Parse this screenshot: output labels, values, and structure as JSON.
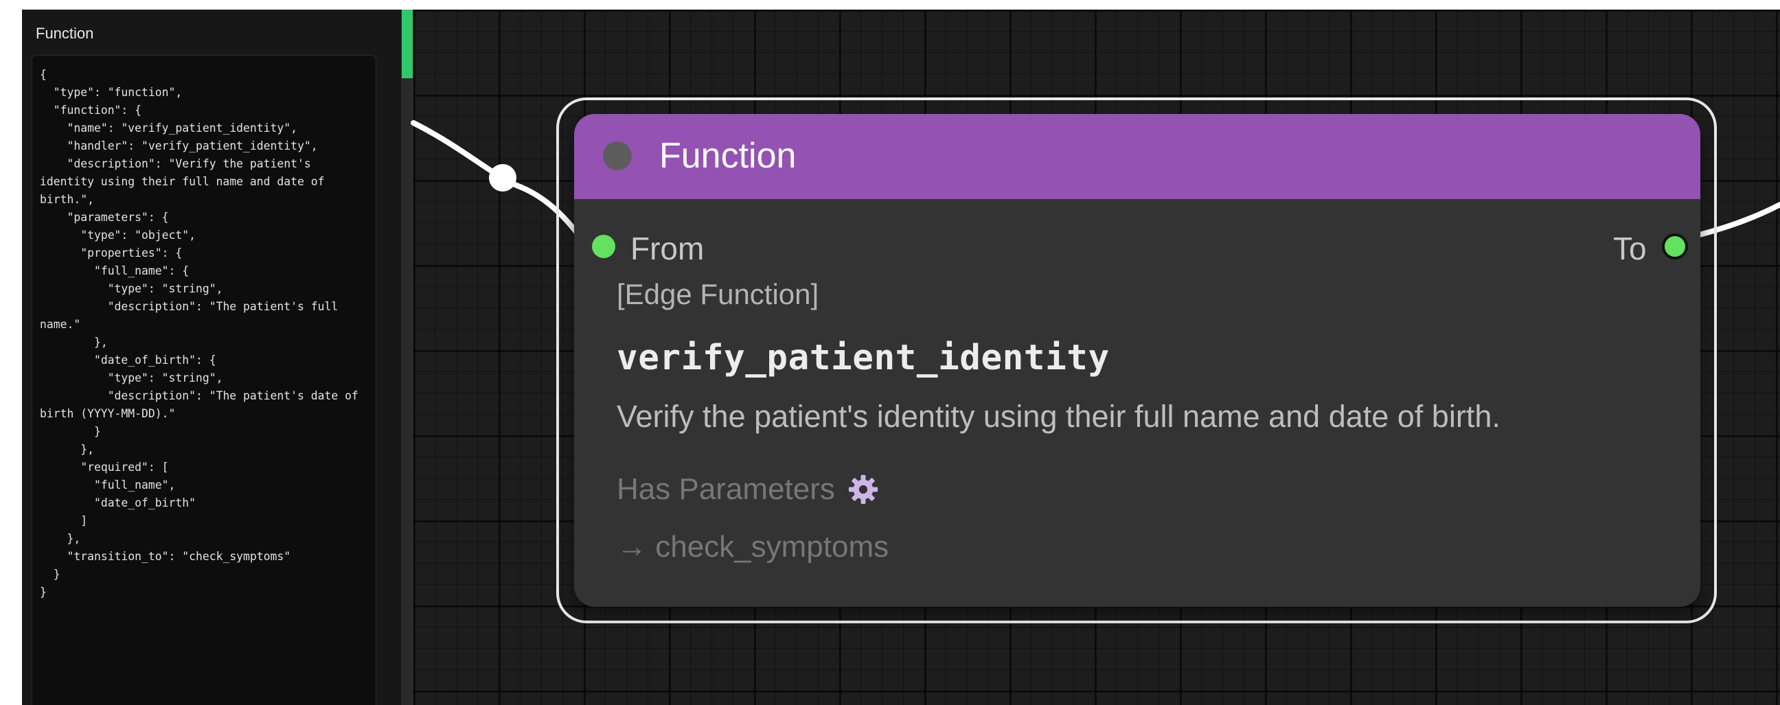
{
  "side_panel": {
    "title": "Function",
    "code": "{\n  \"type\": \"function\",\n  \"function\": {\n    \"name\": \"verify_patient_identity\",\n    \"handler\": \"verify_patient_identity\",\n    \"description\": \"Verify the patient's identity using their full name and date of birth.\",\n    \"parameters\": {\n      \"type\": \"object\",\n      \"properties\": {\n        \"full_name\": {\n          \"type\": \"string\",\n          \"description\": \"The patient's full name.\"\n        },\n        \"date_of_birth\": {\n          \"type\": \"string\",\n          \"description\": \"The patient's date of birth (YYYY-MM-DD).\"\n        }\n      },\n      \"required\": [\n        \"full_name\",\n        \"date_of_birth\"\n      ]\n    },\n    \"transition_to\": \"check_symptoms\"\n  }\n}"
  },
  "node": {
    "title": "Function",
    "from_label": "From",
    "to_label": "To",
    "node_type": "[Edge Function]",
    "function_name": "verify_patient_identity",
    "description": "Verify the patient's identity using their full name and date of birth.",
    "params_label": "Has Parameters",
    "params_icon": "gear-icon",
    "transition": "→ check_symptoms"
  },
  "colors": {
    "header": "#9452b3",
    "port": "#62e25e",
    "scroll_thumb": "#2fc86b",
    "gear": "#cdb6e6"
  }
}
